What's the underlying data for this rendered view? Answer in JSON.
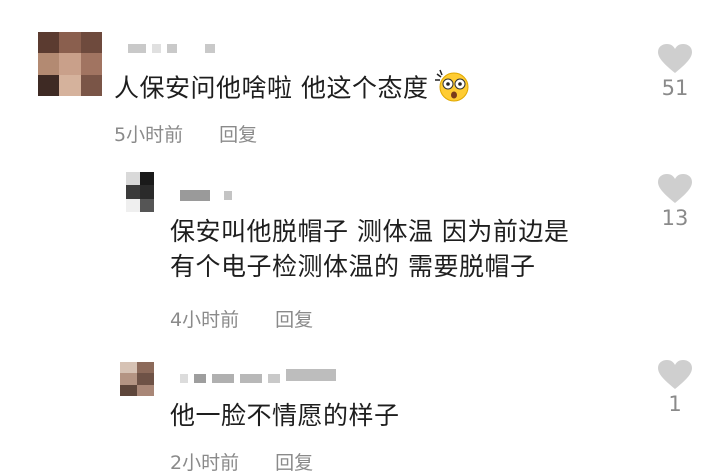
{
  "comments": [
    {
      "text": "人保安问他啥啦 他这个态度",
      "time": "5小时前",
      "reply": "回复",
      "likes": "51",
      "emoji": "astonished-emoji",
      "colors": [
        "#5b3b30",
        "#8a5f4e",
        "#b38a72",
        "#6e4a3d",
        "#c9a08a",
        "#3e2a24",
        "#a17461",
        "#d5b29c",
        "#7a5547"
      ]
    },
    {
      "text_lines": [
        "保安叫他脱帽子 测体温 因为前边是",
        "有个电子检测体温的 需要脱帽子"
      ],
      "time": "4小时前",
      "reply": "回复",
      "likes": "13",
      "colors": [
        "#1a1a1a",
        "#3b3b3b",
        "#d9d9d9",
        "#2a2a2a",
        "#efefef",
        "#555555"
      ]
    },
    {
      "text": "他一脸不情愿的样子",
      "time": "2小时前",
      "reply": "回复",
      "likes": "1",
      "colors": [
        "#8c6a5a",
        "#b49483",
        "#6e5246",
        "#d6c2b4",
        "#5e463b",
        "#a98777"
      ]
    }
  ],
  "icons": {
    "like": "heart-icon"
  }
}
